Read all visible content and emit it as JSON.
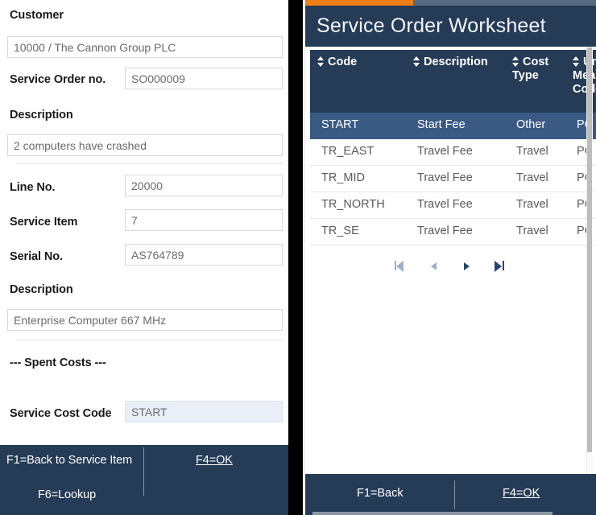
{
  "left_panel": {
    "fields": [
      {
        "label": "Customer",
        "value": "10000 / The Cannon Group PLC",
        "layout": "stacked"
      },
      {
        "label": "Service Order no.",
        "value": "SO000009",
        "layout": "inline"
      },
      {
        "label": "Description",
        "value": "2 computers have crashed",
        "layout": "stacked"
      },
      {
        "label": "Line No.",
        "value": "20000",
        "layout": "inline"
      },
      {
        "label": "Service Item",
        "value": "7",
        "layout": "inline"
      },
      {
        "label": "Serial No.",
        "value": "AS764789",
        "layout": "inline"
      },
      {
        "label": "Description",
        "value": "Enterprise Computer 667 MHz",
        "layout": "stacked"
      }
    ],
    "section_title": "--- Spent Costs ---",
    "cost_code": {
      "label": "Service Cost Code",
      "value": "START"
    },
    "actions": {
      "back": "F1=Back to Service Item",
      "ok": "F4=OK",
      "lookup": "F6=Lookup"
    }
  },
  "right_dialog": {
    "title": "Service Order Worksheet",
    "progress_percent": 37,
    "accent_color": "#ee7f16",
    "header_color": "#253b56",
    "selection_color": "#3a5a84",
    "columns": [
      {
        "header": "Code",
        "sortable": true
      },
      {
        "header": "Description",
        "sortable": true
      },
      {
        "header": "Cost Type",
        "sortable": true
      },
      {
        "header": "Unit of Measure Code",
        "sortable": true
      }
    ],
    "rows": [
      {
        "code": "START",
        "description": "Start Fee",
        "cost_type": "Other",
        "uom": "PC",
        "selected": true
      },
      {
        "code": "TR_EAST",
        "description": "Travel Fee",
        "cost_type": "Travel",
        "uom": "PC",
        "selected": false
      },
      {
        "code": "TR_MID",
        "description": "Travel Fee",
        "cost_type": "Travel",
        "uom": "PC",
        "selected": false
      },
      {
        "code": "TR_NORTH",
        "description": "Travel Fee",
        "cost_type": "Travel",
        "uom": "PC",
        "selected": false
      },
      {
        "code": "TR_SE",
        "description": "Travel Fee",
        "cost_type": "Travel",
        "uom": "PC",
        "selected": false
      }
    ],
    "pager": {
      "first": "first-page",
      "previous": "previous-page",
      "next": "next-page",
      "last": "last-page"
    },
    "actions": {
      "back": "F1=Back",
      "ok": "F4=OK"
    }
  }
}
